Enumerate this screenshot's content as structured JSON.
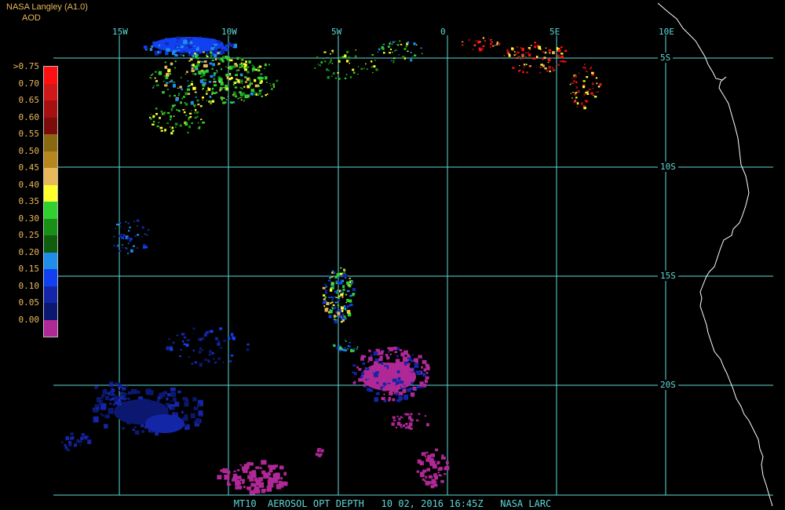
{
  "header": {
    "title": "NASA Langley (A1.0)",
    "subtitle": "AOD"
  },
  "legend": {
    "items": [
      {
        "label": ">0.75",
        "color": "#ff1010"
      },
      {
        "label": "0.70",
        "color": "#d01818"
      },
      {
        "label": "0.65",
        "color": "#a51010"
      },
      {
        "label": "0.60",
        "color": "#7a0c0c"
      },
      {
        "label": "0.55",
        "color": "#8a6810"
      },
      {
        "label": "0.50",
        "color": "#b8861e"
      },
      {
        "label": "0.45",
        "color": "#e8b85a"
      },
      {
        "label": "0.40",
        "color": "#ffff30"
      },
      {
        "label": "0.35",
        "color": "#30d030"
      },
      {
        "label": "0.30",
        "color": "#189018"
      },
      {
        "label": "0.25",
        "color": "#0e5e0e"
      },
      {
        "label": "0.20",
        "color": "#1e8ee8"
      },
      {
        "label": "0.15",
        "color": "#1040f0"
      },
      {
        "label": "0.10",
        "color": "#1426a8"
      },
      {
        "label": "0.05",
        "color": "#0c1870"
      },
      {
        "label": "0.00",
        "color": "#b02896"
      }
    ]
  },
  "grid": {
    "longitude_labels": [
      "15W",
      "10W",
      "5W",
      "0",
      "5E",
      "10E"
    ],
    "latitude_labels": [
      "5S",
      "10S",
      "15S",
      "20S"
    ],
    "line_color": "#5fd8d8"
  },
  "footer": {
    "text": "MT10  AEROSOL OPT DEPTH   10 02, 2016 16:45Z   NASA LARC"
  },
  "colors": {
    "background": "#000000",
    "coastline": "#ffffff",
    "label": "#e8b85a"
  }
}
